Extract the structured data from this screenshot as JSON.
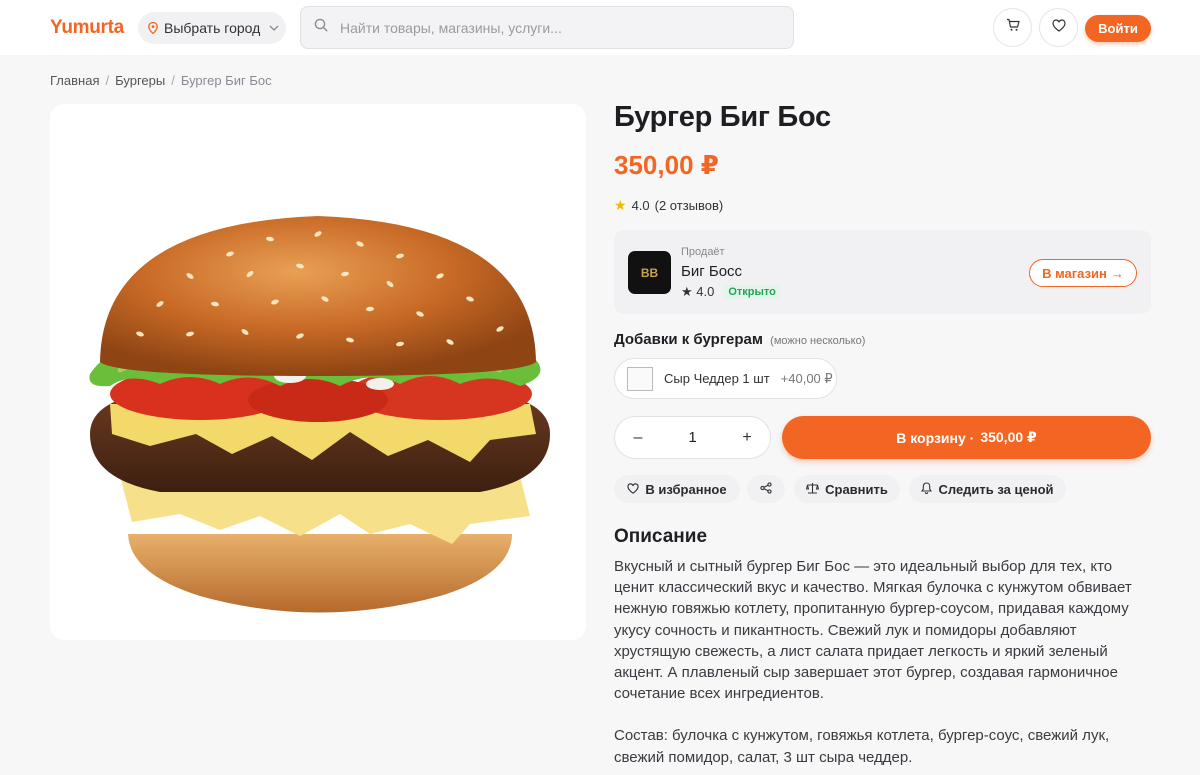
{
  "header": {
    "logo": "Yumurta",
    "city_label": "Выбрать город",
    "search_placeholder": "Найти товары, магазины, услуги...",
    "login_label": "Войти"
  },
  "breadcrumb": [
    "Главная",
    "Бургеры",
    "Бургер Биг Бос"
  ],
  "product": {
    "title": "Бургер Биг Бос",
    "price": "350,00 ₽",
    "rating": "4.0",
    "reviews": "(2 отзывов)"
  },
  "seller": {
    "caption": "Продаёт",
    "name": "Биг Босс",
    "rating": "★ 4.0",
    "status": "Открыто",
    "shop_button": "В магазин",
    "logo_text": "BB"
  },
  "addons": {
    "title": "Добавки к бургерам",
    "hint": "(можно несколько)",
    "items": [
      {
        "name": "Сыр Чеддер 1 шт",
        "price": "+40,00 ₽"
      }
    ]
  },
  "purchase": {
    "quantity": "1",
    "minus": "–",
    "plus": "+",
    "cart_label": "В корзину ·",
    "cart_price": "350,00 ₽"
  },
  "actions": {
    "favorite": "В избранное",
    "compare": "Сравнить",
    "watch_price": "Следить за ценой"
  },
  "description": {
    "title": "Описание",
    "paragraph1": "Вкусный и сытный бургер Биг Бос — это идеальный выбор для тех, кто ценит классический вкус и качество. Мягкая булочка с кунжутом обвивает нежную говяжью котлету, пропитанную бургер-соусом, придавая каждому укусу сочность и пикантность. Свежий лук и помидоры добавляют хрустящую свежесть, а лист салата придает легкость и яркий зеленый акцент. А плавленый сыр завершает этот бургер, создавая гармоничное сочетание всех ингредиентов.",
    "paragraph2": "Состав: булочка с кунжутом, говяжья котлета, бургер-соус, свежий лук, свежий помидор, салат, 3 шт сыра чеддер."
  },
  "colors": {
    "accent": "#f26522",
    "open_green": "#1fa45a",
    "star": "#f5b800"
  },
  "icons": [
    "location-pin-icon",
    "chevron-down-icon",
    "search-icon",
    "cart-icon",
    "heart-icon",
    "star-icon",
    "arrow-right-icon",
    "share-icon",
    "scales-icon",
    "bell-icon"
  ]
}
